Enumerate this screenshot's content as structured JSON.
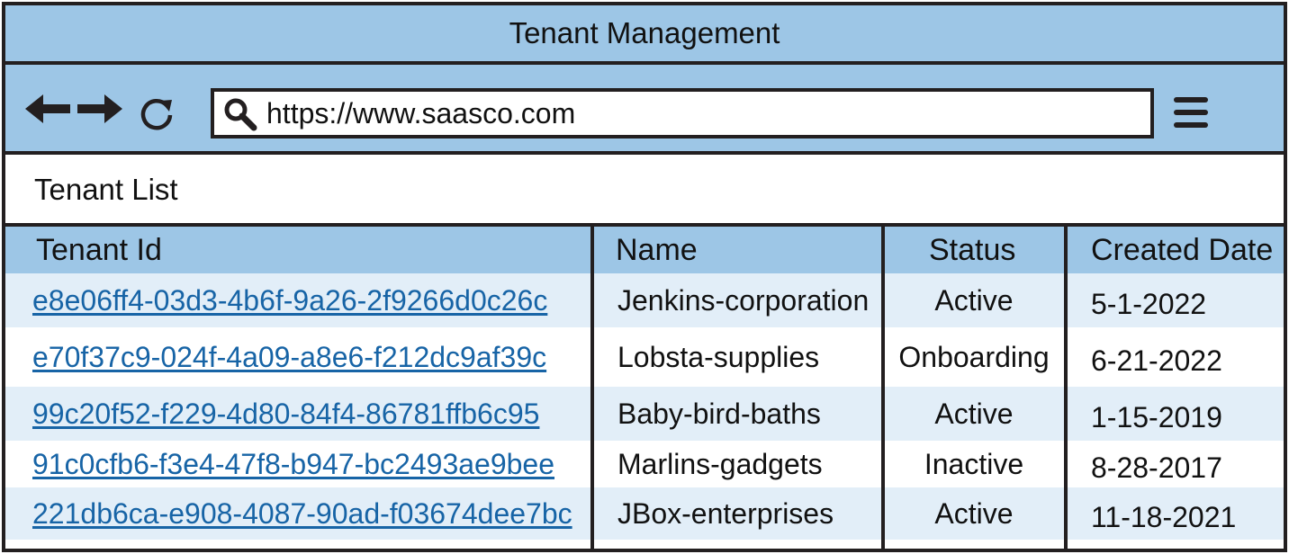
{
  "window": {
    "title": "Tenant Management"
  },
  "toolbar": {
    "url": "https://www.saasco.com",
    "icons": [
      "back-arrow-icon",
      "forward-arrow-icon",
      "refresh-icon",
      "search-icon",
      "hamburger-menu-icon"
    ]
  },
  "page": {
    "title": "Tenant List"
  },
  "table": {
    "columns": [
      "Tenant Id",
      "Name",
      "Status",
      "Created Date"
    ],
    "rows": [
      {
        "id": "e8e06ff4-03d3-4b6f-9a26-2f9266d0c26c",
        "name": "Jenkins-corporation",
        "status": "Active",
        "created": "5-1-2022"
      },
      {
        "id": "e70f37c9-024f-4a09-a8e6-f212dc9af39c",
        "name": "Lobsta-supplies",
        "status": "Onboarding",
        "created": "6-21-2022"
      },
      {
        "id": "99c20f52-f229-4d80-84f4-86781ffb6c95",
        "name": "Baby-bird-baths",
        "status": "Active",
        "created": "1-15-2019"
      },
      {
        "id": "91c0cfb6-f3e4-47f8-b947-bc2493ae9bee",
        "name": "Marlins-gadgets",
        "status": "Inactive",
        "created": "8-28-2017"
      },
      {
        "id": "221db6ca-e908-4087-90ad-f03674dee7bc",
        "name": "JBox-enterprises",
        "status": "Active",
        "created": "11-18-2021"
      }
    ]
  },
  "colors": {
    "chrome": "#9dc6e6",
    "row_alt": "#e2eef8",
    "link": "#1764a6",
    "border": "#231f20"
  }
}
